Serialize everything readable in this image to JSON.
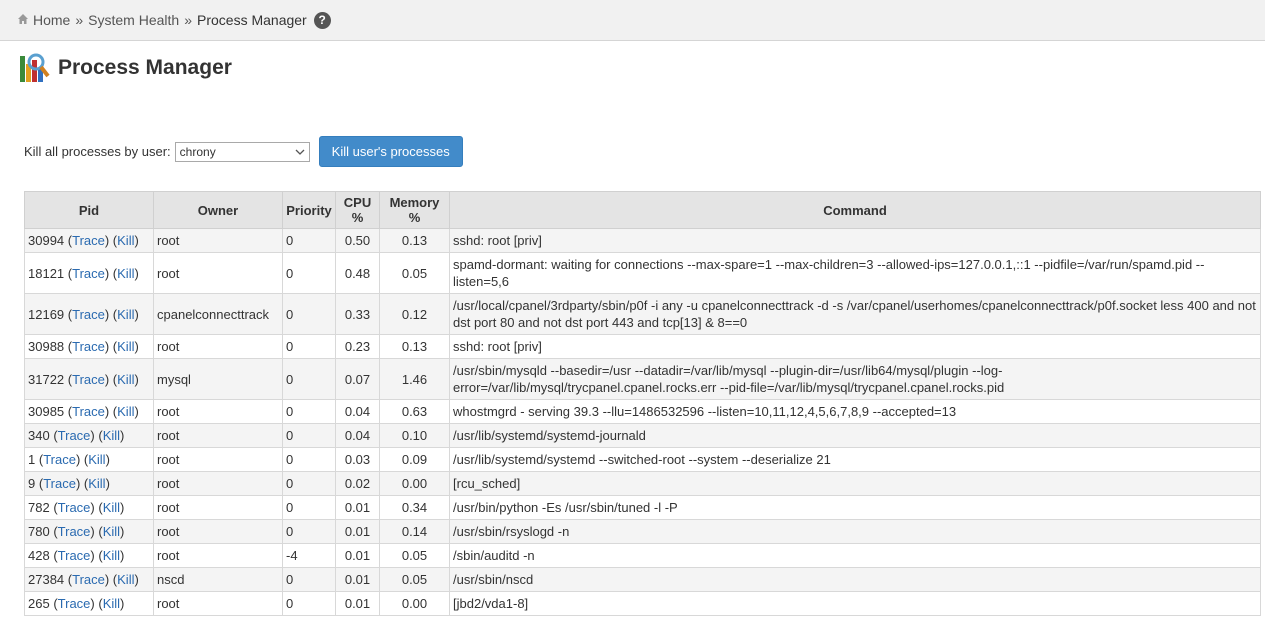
{
  "breadcrumb": {
    "home": "Home",
    "section": "System Health",
    "current": "Process Manager",
    "sep": "»"
  },
  "page": {
    "title": "Process Manager"
  },
  "controls": {
    "label": "Kill all processes by user:",
    "selected_user": "chrony",
    "kill_button": "Kill user's processes"
  },
  "table": {
    "headers": {
      "pid": "Pid",
      "owner": "Owner",
      "priority": "Priority",
      "cpu": "CPU %",
      "memory": "Memory %",
      "command": "Command"
    },
    "trace_label": "Trace",
    "kill_label": "Kill",
    "rows": [
      {
        "pid": "30994",
        "owner": "root",
        "priority": "0",
        "cpu": "0.50",
        "memory": "0.13",
        "command": "sshd: root [priv]"
      },
      {
        "pid": "18121",
        "owner": "root",
        "priority": "0",
        "cpu": "0.48",
        "memory": "0.05",
        "command": "spamd-dormant: waiting for connections --max-spare=1 --max-children=3 --allowed-ips=127.0.0.1,::1 --pidfile=/var/run/spamd.pid --listen=5,6"
      },
      {
        "pid": "12169",
        "owner": "cpanelconnecttrack",
        "priority": "0",
        "cpu": "0.33",
        "memory": "0.12",
        "command": "/usr/local/cpanel/3rdparty/sbin/p0f -i any -u cpanelconnecttrack -d -s /var/cpanel/userhomes/cpanelconnecttrack/p0f.socket less 400 and not dst port 80 and not dst port 443 and tcp[13] & 8==0"
      },
      {
        "pid": "30988",
        "owner": "root",
        "priority": "0",
        "cpu": "0.23",
        "memory": "0.13",
        "command": "sshd: root [priv]"
      },
      {
        "pid": "31722",
        "owner": "mysql",
        "priority": "0",
        "cpu": "0.07",
        "memory": "1.46",
        "command": "/usr/sbin/mysqld --basedir=/usr --datadir=/var/lib/mysql --plugin-dir=/usr/lib64/mysql/plugin --log-error=/var/lib/mysql/trycpanel.cpanel.rocks.err --pid-file=/var/lib/mysql/trycpanel.cpanel.rocks.pid"
      },
      {
        "pid": "30985",
        "owner": "root",
        "priority": "0",
        "cpu": "0.04",
        "memory": "0.63",
        "command": "whostmgrd - serving 39.3 --llu=1486532596 --listen=10,11,12,4,5,6,7,8,9 --accepted=13"
      },
      {
        "pid": "340",
        "owner": "root",
        "priority": "0",
        "cpu": "0.04",
        "memory": "0.10",
        "command": "/usr/lib/systemd/systemd-journald"
      },
      {
        "pid": "1",
        "owner": "root",
        "priority": "0",
        "cpu": "0.03",
        "memory": "0.09",
        "command": "/usr/lib/systemd/systemd --switched-root --system --deserialize 21"
      },
      {
        "pid": "9",
        "owner": "root",
        "priority": "0",
        "cpu": "0.02",
        "memory": "0.00",
        "command": "[rcu_sched]"
      },
      {
        "pid": "782",
        "owner": "root",
        "priority": "0",
        "cpu": "0.01",
        "memory": "0.34",
        "command": "/usr/bin/python -Es /usr/sbin/tuned -l -P"
      },
      {
        "pid": "780",
        "owner": "root",
        "priority": "0",
        "cpu": "0.01",
        "memory": "0.14",
        "command": "/usr/sbin/rsyslogd -n"
      },
      {
        "pid": "428",
        "owner": "root",
        "priority": "-4",
        "cpu": "0.01",
        "memory": "0.05",
        "command": "/sbin/auditd -n"
      },
      {
        "pid": "27384",
        "owner": "nscd",
        "priority": "0",
        "cpu": "0.01",
        "memory": "0.05",
        "command": "/usr/sbin/nscd"
      },
      {
        "pid": "265",
        "owner": "root",
        "priority": "0",
        "cpu": "0.01",
        "memory": "0.00",
        "command": "[jbd2/vda1-8]"
      }
    ]
  }
}
